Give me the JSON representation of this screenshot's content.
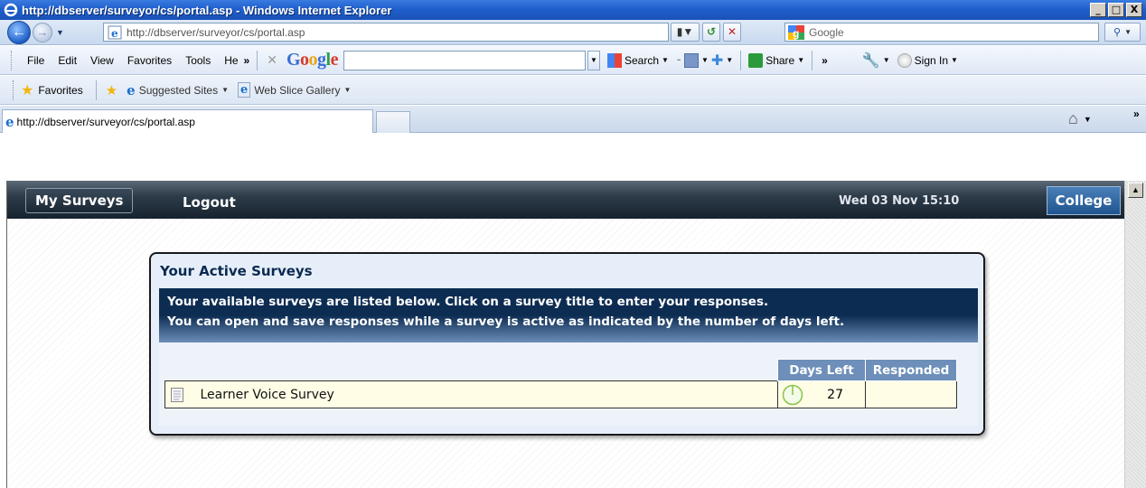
{
  "window": {
    "title": "http://dbserver/surveyor/cs/portal.asp - Windows Internet Explorer",
    "buttons": [
      "_",
      "□",
      "X"
    ]
  },
  "address_bar": {
    "url": "http://dbserver/surveyor/cs/portal.asp",
    "search_placeholder": "Google"
  },
  "menu": {
    "items": [
      "File",
      "Edit",
      "View",
      "Favorites",
      "Tools",
      "He"
    ],
    "more": "»",
    "google_search_label": "Search",
    "share_label": "Share",
    "sign_in_label": "Sign In"
  },
  "favorites_bar": {
    "favorites_label": "Favorites",
    "links": [
      "Suggested Sites",
      "Web Slice Gallery"
    ]
  },
  "tabs": [
    {
      "label": "http://dbserver/surveyor/cs/portal.asp",
      "active": true
    }
  ],
  "app": {
    "nav": {
      "my_surveys": "My Surveys",
      "logout": "Logout",
      "datetime": "Wed 03 Nov 15:10",
      "college": "College"
    },
    "panel": {
      "title": "Your Active Surveys",
      "message_line1": "Your available surveys are listed below. Click on a survey title to enter your responses.",
      "message_line2": "You can open and save responses while a survey is active as indicated by the number of days left.",
      "columns": [
        "Days Left",
        "Responded"
      ],
      "rows": [
        {
          "title": "Learner Voice Survey",
          "days_left": "27",
          "responded": ""
        }
      ]
    }
  },
  "colors": {
    "title_bar": "#1f5fcc",
    "app_nav": "#16222e",
    "panel_header": "#0d2c52",
    "table_header": "#6d8fb9",
    "row_bg": "#fffde6",
    "college_btn": "#1f5590"
  }
}
